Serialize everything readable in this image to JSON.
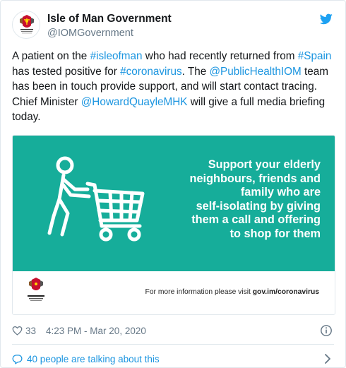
{
  "account": {
    "display_name": "Isle of Man Government",
    "handle": "@IOMGovernment",
    "avatar_icon": "isle-of-man-crest-icon"
  },
  "tweet": {
    "segments": [
      {
        "text": "A patient on the ",
        "link": false
      },
      {
        "text": "#isleofman",
        "link": true
      },
      {
        "text": " who had recently returned from ",
        "link": false
      },
      {
        "text": "#Spain",
        "link": true
      },
      {
        "text": " has tested positive for ",
        "link": false
      },
      {
        "text": "#coronavirus",
        "link": true
      },
      {
        "text": ". The ",
        "link": false
      },
      {
        "text": "@PublicHealthIOM",
        "link": true
      },
      {
        "text": " team has been in touch provide support, and will start contact tracing. Chief Minister ",
        "link": false
      },
      {
        "text": "@HowardQuayleMHK",
        "link": true
      },
      {
        "text": " will give a full media briefing today.",
        "link": false
      }
    ]
  },
  "media": {
    "promo_lines": [
      "Support your elderly",
      "neighbours, friends and",
      "family who are",
      "self-isolating by giving",
      "them a call and offering",
      "to shop for them"
    ],
    "info_prefix": "For more information please visit ",
    "info_url": "gov.im/coronavirus",
    "logo_caption": "Isle of Man Government",
    "bg_color": "#16ad9a"
  },
  "footer": {
    "likes": "33",
    "timestamp": "4:23 PM - Mar 20, 2020",
    "talking": "40 people are talking about this"
  },
  "colors": {
    "link": "#1b95e0",
    "muted": "#657786"
  }
}
